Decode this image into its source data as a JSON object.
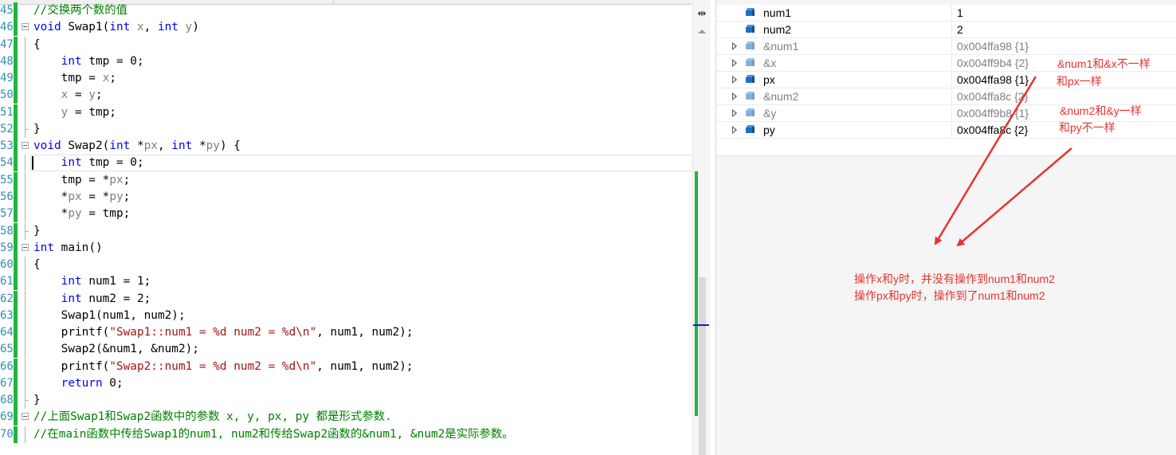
{
  "editor": {
    "lines": [
      {
        "num": "45",
        "code": [
          {
            "t": "//交换两个数的值",
            "c": "cm"
          }
        ]
      },
      {
        "num": "46",
        "fold": true,
        "code": [
          {
            "t": "void",
            "c": "kw"
          },
          {
            "t": " Swap1("
          },
          {
            "t": "int",
            "c": "kw"
          },
          {
            "t": " "
          },
          {
            "t": "x",
            "c": "par"
          },
          {
            "t": ", "
          },
          {
            "t": "int",
            "c": "kw"
          },
          {
            "t": " "
          },
          {
            "t": "y",
            "c": "par"
          },
          {
            "t": ")"
          }
        ]
      },
      {
        "num": "47",
        "guide": "mid",
        "code": [
          {
            "t": "{"
          }
        ]
      },
      {
        "num": "48",
        "guide": "mid",
        "code": [
          {
            "t": "    "
          },
          {
            "t": "int",
            "c": "kw"
          },
          {
            "t": " tmp = 0;"
          }
        ]
      },
      {
        "num": "49",
        "guide": "mid",
        "code": [
          {
            "t": "    tmp = "
          },
          {
            "t": "x",
            "c": "par"
          },
          {
            "t": ";"
          }
        ]
      },
      {
        "num": "50",
        "guide": "mid",
        "code": [
          {
            "t": "    "
          },
          {
            "t": "x",
            "c": "par"
          },
          {
            "t": " = "
          },
          {
            "t": "y",
            "c": "par"
          },
          {
            "t": ";"
          }
        ]
      },
      {
        "num": "51",
        "guide": "mid",
        "code": [
          {
            "t": "    "
          },
          {
            "t": "y",
            "c": "par"
          },
          {
            "t": " = tmp;"
          }
        ]
      },
      {
        "num": "52",
        "guide": "end",
        "code": [
          {
            "t": "}"
          }
        ]
      },
      {
        "num": "53",
        "fold": true,
        "code": [
          {
            "t": "void",
            "c": "kw"
          },
          {
            "t": " Swap2("
          },
          {
            "t": "int",
            "c": "kw"
          },
          {
            "t": " *"
          },
          {
            "t": "px",
            "c": "par"
          },
          {
            "t": ", "
          },
          {
            "t": "int",
            "c": "kw"
          },
          {
            "t": " *"
          },
          {
            "t": "py",
            "c": "par"
          },
          {
            "t": ") {"
          }
        ]
      },
      {
        "num": "54",
        "guide": "mid",
        "current": true,
        "code": [
          {
            "t": "    "
          },
          {
            "t": "int",
            "c": "kw"
          },
          {
            "t": " tmp = 0;"
          }
        ]
      },
      {
        "num": "55",
        "guide": "mid",
        "code": [
          {
            "t": "    tmp = *"
          },
          {
            "t": "px",
            "c": "par"
          },
          {
            "t": ";"
          }
        ]
      },
      {
        "num": "56",
        "guide": "mid",
        "code": [
          {
            "t": "    *"
          },
          {
            "t": "px",
            "c": "par"
          },
          {
            "t": " = *"
          },
          {
            "t": "py",
            "c": "par"
          },
          {
            "t": ";"
          }
        ]
      },
      {
        "num": "57",
        "guide": "mid",
        "code": [
          {
            "t": "    *"
          },
          {
            "t": "py",
            "c": "par"
          },
          {
            "t": " = tmp;"
          }
        ]
      },
      {
        "num": "58",
        "guide": "end",
        "code": [
          {
            "t": "}"
          }
        ]
      },
      {
        "num": "59",
        "fold": true,
        "code": [
          {
            "t": "int",
            "c": "kw"
          },
          {
            "t": " main()"
          }
        ]
      },
      {
        "num": "60",
        "guide": "mid",
        "code": [
          {
            "t": "{"
          }
        ]
      },
      {
        "num": "61",
        "guide": "mid",
        "code": [
          {
            "t": "    "
          },
          {
            "t": "int",
            "c": "kw"
          },
          {
            "t": " num1 = 1;"
          }
        ]
      },
      {
        "num": "62",
        "guide": "mid",
        "code": [
          {
            "t": "    "
          },
          {
            "t": "int",
            "c": "kw"
          },
          {
            "t": " num2 = 2;"
          }
        ]
      },
      {
        "num": "63",
        "guide": "mid",
        "code": [
          {
            "t": "    Swap1(num1, num2);"
          }
        ]
      },
      {
        "num": "64",
        "guide": "mid",
        "code": [
          {
            "t": "    printf("
          },
          {
            "t": "\"Swap1::num1 = %d num2 = %d\\n\"",
            "c": "str"
          },
          {
            "t": ", num1, num2);"
          }
        ]
      },
      {
        "num": "65",
        "guide": "mid",
        "code": [
          {
            "t": "    Swap2(&num1, &num2);"
          }
        ]
      },
      {
        "num": "66",
        "guide": "mid",
        "code": [
          {
            "t": "    printf("
          },
          {
            "t": "\"Swap2::num1 = %d num2 = %d\\n\"",
            "c": "str"
          },
          {
            "t": ", num1, num2);"
          }
        ]
      },
      {
        "num": "67",
        "guide": "mid",
        "code": [
          {
            "t": "    "
          },
          {
            "t": "return",
            "c": "kw"
          },
          {
            "t": " 0;"
          }
        ]
      },
      {
        "num": "68",
        "guide": "end",
        "code": [
          {
            "t": "}"
          }
        ]
      },
      {
        "num": "69",
        "fold": true,
        "code": [
          {
            "t": "//上面Swap1和Swap2函数中的参数 x, y, px, py 都是形式参数.",
            "c": "cm"
          }
        ]
      },
      {
        "num": "70",
        "guide": "mid",
        "code": [
          {
            "t": "//在main函数中传给Swap1的num1, num2和传给Swap2函数的&num1, &num2是实际参数。",
            "c": "cm"
          }
        ]
      }
    ]
  },
  "scrollbar": {
    "split_icon": "split-window-icon",
    "split_glyph": "⇹",
    "up_icon": "scroll-up-arrow-icon"
  },
  "watch": {
    "rows": [
      {
        "name": "num1",
        "value": "1",
        "expandable": false,
        "stale": false,
        "icon": "variable-icon"
      },
      {
        "name": "num2",
        "value": "2",
        "expandable": false,
        "stale": false,
        "icon": "variable-icon"
      },
      {
        "name": "&num1",
        "value": "0x004ffa98 {1}",
        "expandable": true,
        "stale": true,
        "icon": "variable-icon"
      },
      {
        "name": "&x",
        "value": "0x004ff9b4 {2}",
        "expandable": true,
        "stale": true,
        "icon": "variable-icon"
      },
      {
        "name": "px",
        "value": "0x004ffa98 {1}",
        "expandable": true,
        "stale": false,
        "icon": "variable-icon"
      },
      {
        "name": "&num2",
        "value": "0x004ffa8c {2}",
        "expandable": true,
        "stale": true,
        "icon": "variable-icon"
      },
      {
        "name": "&y",
        "value": "0x004ff9b8 {1}",
        "expandable": true,
        "stale": true,
        "icon": "variable-icon"
      },
      {
        "name": "py",
        "value": "0x004ffa8c {2}",
        "expandable": true,
        "stale": false,
        "icon": "variable-icon"
      }
    ]
  },
  "annotations": {
    "note1_line1": "&num1和&x不一样",
    "note1_line2": "和px一样",
    "note2_line1": "&num2和&y一样",
    "note2_line2": "和py不一样",
    "summary_line1": "操作x和y时，并没有操作到num1和num2",
    "summary_line2": "操作px和py时，操作到了num1和num2",
    "color": "#e8332f"
  },
  "colors": {
    "keyword": "#0000ff",
    "parameter": "#808080",
    "string": "#a31515",
    "comment": "#008000",
    "line_number": "#2b91af",
    "change_bar": "#1fb53c"
  }
}
